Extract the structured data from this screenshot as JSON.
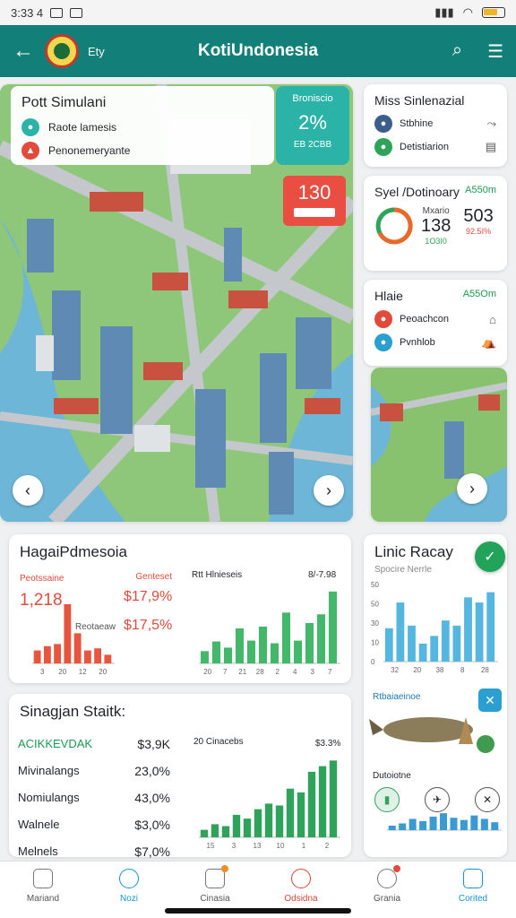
{
  "status_bar": {
    "time": "3:33 4",
    "icons": [
      "message-icon",
      "wifi-icon",
      "battery-icon"
    ]
  },
  "app_bar": {
    "title": "KotiUndonesia",
    "subtitle": "Ety"
  },
  "map_panel": {
    "title": "Pott Simulani",
    "items": [
      "Raote lamesis",
      "Penonemeryante"
    ],
    "teal_badge": {
      "label": "Broniscio",
      "value": "2%",
      "sub": "EB 2CBB"
    },
    "red_badge": {
      "value": "130"
    }
  },
  "mini_card_1": {
    "title": "Miss Sinlenazial",
    "items": [
      "Stbhine",
      "Detistiarion"
    ]
  },
  "mini_card_2": {
    "title": "Syel /Dotinoary",
    "accent": "A550m",
    "col1": {
      "label": "Mxario",
      "value": "138",
      "sub": "1O3I0"
    },
    "col2": {
      "label": "",
      "value": "503",
      "sub": "92.5I%"
    }
  },
  "mini_card_3": {
    "title": "Hlaie",
    "accent": "A55Om",
    "items": [
      "Peoachcon",
      "Pvnhlob"
    ]
  },
  "card_harga": {
    "title": "HagaiPdmesoia",
    "left_label": "Peotssaine",
    "left_value": "1,218",
    "right_label": "Genteset",
    "right_value1": "$17,9%",
    "right_value2": "$17,5%",
    "right_chart_label": "Rtt Hlnieseis",
    "right_chart_value": "8/-7.98",
    "bar_chart_label": "Reotaeaw"
  },
  "card_sinagjan": {
    "title": "Sinagjan Staitk:",
    "rows": [
      {
        "label": "ACIKKEVDAK",
        "value": "$3,9K"
      },
      {
        "label": "Mivinalangs",
        "value": "23,0%"
      },
      {
        "label": "Nomiulangs",
        "value": "43,0%"
      },
      {
        "label": "Walnele",
        "value": "$3,0%"
      },
      {
        "label": "Melnels",
        "value": "$7,0%"
      }
    ],
    "chart_label": "20 Cinacebs",
    "chart_value": "$3.3%"
  },
  "card_lindc": {
    "title": "Linic Racay",
    "sub": "Spocire Nerrle",
    "illustration_label": "Rtbaiaeinoe",
    "section_label": "Dutoiotne"
  },
  "bottom_nav": [
    "Mariand",
    "Nozi",
    "Cinasia",
    "Odsidna",
    "Grania",
    "Corited"
  ],
  "chart_data": [
    {
      "type": "bar",
      "title": "",
      "categories": [
        "1",
        "2",
        "3",
        "4",
        "5",
        "6",
        "7",
        "8"
      ],
      "values": [
        12,
        16,
        18,
        55,
        28,
        12,
        14,
        8
      ],
      "ylim": [
        0,
        60
      ],
      "xticks": [
        "3",
        "20",
        "12",
        "20"
      ]
    },
    {
      "type": "bar",
      "title": "",
      "categories": [
        "1",
        "2",
        "3",
        "4",
        "5",
        "6",
        "7",
        "8",
        "9",
        "10",
        "11",
        "12"
      ],
      "values": [
        14,
        25,
        18,
        40,
        26,
        42,
        23,
        58,
        26,
        46,
        56,
        82
      ],
      "ylim": [
        0,
        90
      ],
      "xticks": [
        "20",
        "7",
        "21",
        "28",
        "2",
        "4",
        "3",
        "7"
      ]
    },
    {
      "type": "bar",
      "title": "",
      "categories": [
        "1",
        "2",
        "3",
        "4",
        "5",
        "6",
        "7",
        "8",
        "9",
        "10",
        "11",
        "12",
        "13"
      ],
      "values": [
        8,
        14,
        12,
        24,
        20,
        30,
        36,
        34,
        52,
        48,
        70,
        76,
        82
      ],
      "ylim": [
        0,
        90
      ],
      "xticks": [
        "15",
        "3",
        "13",
        "10",
        "1",
        "2"
      ]
    },
    {
      "type": "bar",
      "title": "",
      "categories": [
        "1",
        "2",
        "3",
        "4",
        "5",
        "6",
        "7",
        "8",
        "9",
        "10"
      ],
      "values": [
        26,
        46,
        28,
        14,
        20,
        32,
        28,
        50,
        46,
        54
      ],
      "ylim": [
        0,
        60
      ],
      "yticks": [
        "50",
        "50",
        "30",
        "10",
        "0"
      ],
      "xticks": [
        "32",
        "20",
        "38",
        "8",
        "28"
      ]
    },
    {
      "type": "bar",
      "title": "",
      "categories": [
        "1",
        "2",
        "3",
        "4",
        "5",
        "6",
        "7",
        "8",
        "9",
        "10",
        "11"
      ],
      "values": [
        8,
        12,
        20,
        16,
        24,
        30,
        22,
        18,
        26,
        20,
        14
      ],
      "ylim": [
        0,
        35
      ]
    }
  ]
}
